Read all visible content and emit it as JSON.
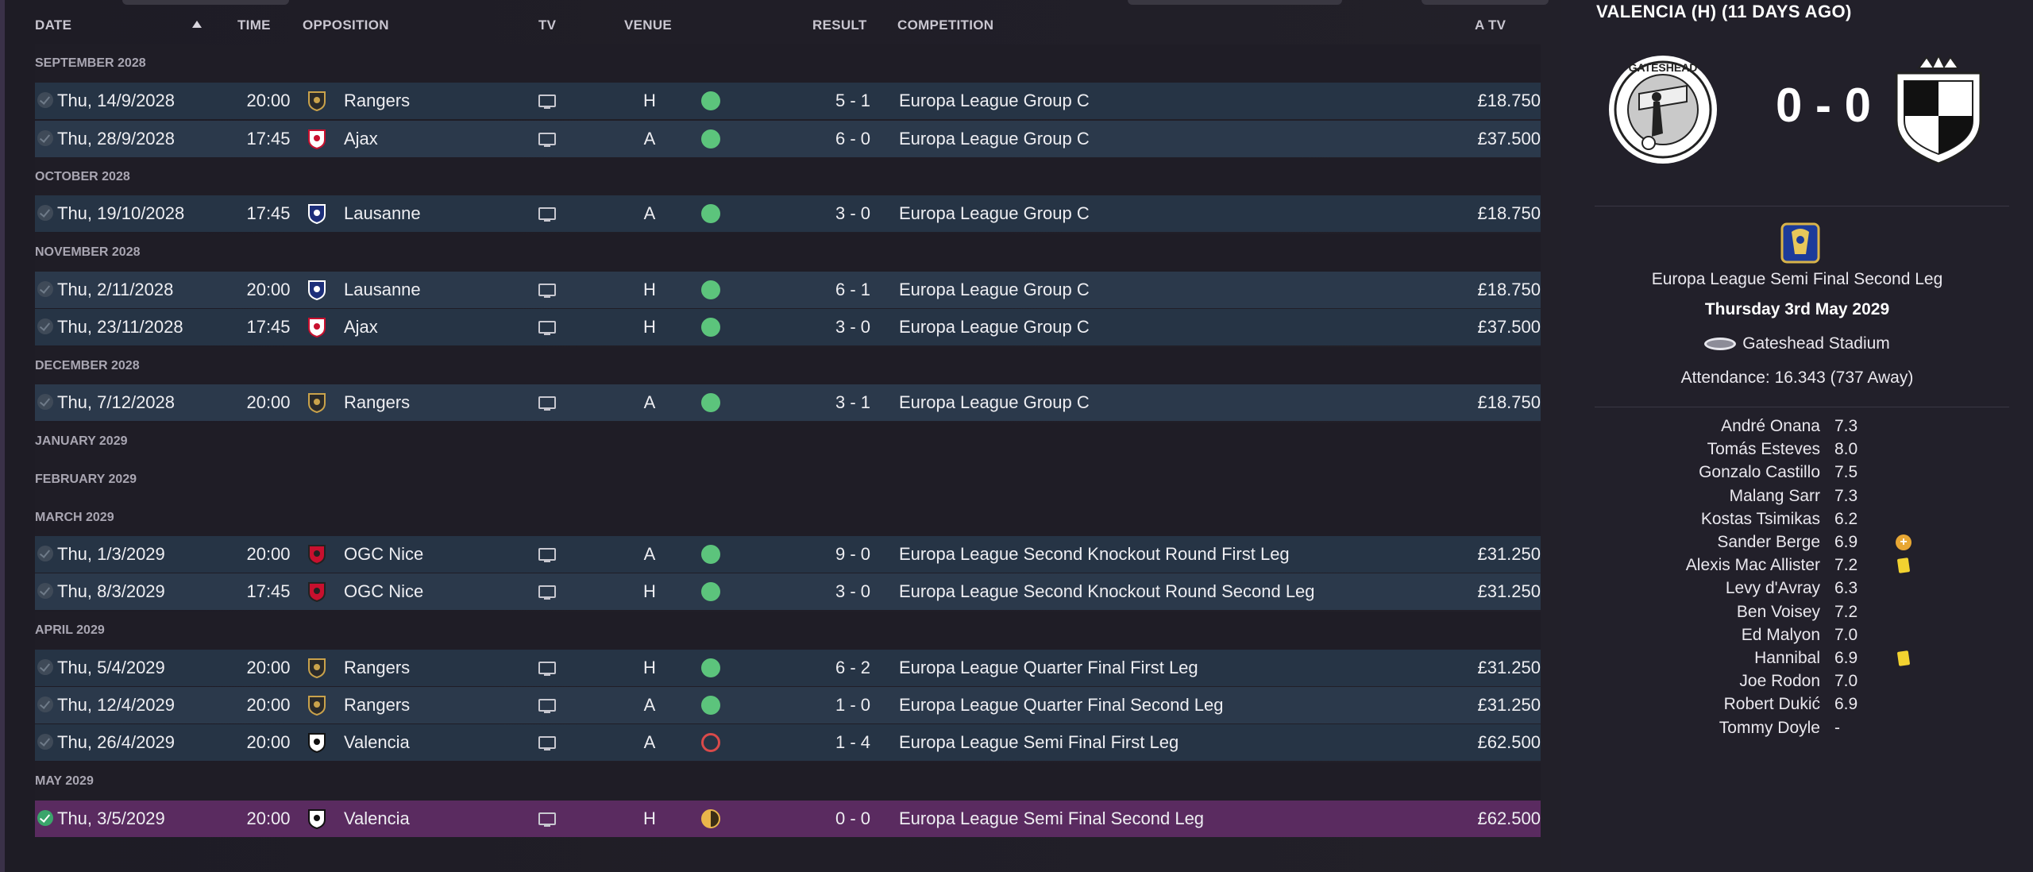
{
  "table": {
    "headers": {
      "date": "DATE",
      "time": "TIME",
      "opposition": "OPPOSITION",
      "tv": "TV",
      "venue": "VENUE",
      "result": "RESULT",
      "competition": "COMPETITION",
      "atv": "A TV"
    },
    "months": [
      "SEPTEMBER 2028",
      "OCTOBER 2028",
      "NOVEMBER 2028",
      "DECEMBER 2028",
      "JANUARY 2029",
      "FEBRUARY 2029",
      "MARCH 2029",
      "APRIL 2029",
      "MAY 2029"
    ],
    "rows": [
      {
        "date": "Thu, 14/9/2028",
        "time": "20:00",
        "opposition": "Rangers",
        "venue": "H",
        "outcome": "win",
        "result": "5 - 1",
        "competition": "Europa League Group C",
        "atv": "£18.750"
      },
      {
        "date": "Thu, 28/9/2028",
        "time": "17:45",
        "opposition": "Ajax",
        "venue": "A",
        "outcome": "win",
        "result": "6 - 0",
        "competition": "Europa League Group C",
        "atv": "£37.500"
      },
      {
        "date": "Thu, 19/10/2028",
        "time": "17:45",
        "opposition": "Lausanne",
        "venue": "A",
        "outcome": "win",
        "result": "3 - 0",
        "competition": "Europa League Group C",
        "atv": "£18.750"
      },
      {
        "date": "Thu, 2/11/2028",
        "time": "20:00",
        "opposition": "Lausanne",
        "venue": "H",
        "outcome": "win",
        "result": "6 - 1",
        "competition": "Europa League Group C",
        "atv": "£18.750"
      },
      {
        "date": "Thu, 23/11/2028",
        "time": "17:45",
        "opposition": "Ajax",
        "venue": "H",
        "outcome": "win",
        "result": "3 - 0",
        "competition": "Europa League Group C",
        "atv": "£37.500"
      },
      {
        "date": "Thu, 7/12/2028",
        "time": "20:00",
        "opposition": "Rangers",
        "venue": "A",
        "outcome": "win",
        "result": "3 - 1",
        "competition": "Europa League Group C",
        "atv": "£18.750"
      },
      {
        "date": "Thu, 1/3/2029",
        "time": "20:00",
        "opposition": "OGC Nice",
        "venue": "A",
        "outcome": "win",
        "result": "9 - 0",
        "competition": "Europa League Second Knockout Round First Leg",
        "atv": "£31.250"
      },
      {
        "date": "Thu, 8/3/2029",
        "time": "17:45",
        "opposition": "OGC Nice",
        "venue": "H",
        "outcome": "win",
        "result": "3 - 0",
        "competition": "Europa League Second Knockout Round Second Leg",
        "atv": "£31.250"
      },
      {
        "date": "Thu, 5/4/2029",
        "time": "20:00",
        "opposition": "Rangers",
        "venue": "H",
        "outcome": "win",
        "result": "6 - 2",
        "competition": "Europa League Quarter Final First Leg",
        "atv": "£31.250"
      },
      {
        "date": "Thu, 12/4/2029",
        "time": "20:00",
        "opposition": "Rangers",
        "venue": "A",
        "outcome": "win",
        "result": "1 - 0",
        "competition": "Europa League Quarter Final Second Leg",
        "atv": "£31.250"
      },
      {
        "date": "Thu, 26/4/2029",
        "time": "20:00",
        "opposition": "Valencia",
        "venue": "A",
        "outcome": "loss",
        "result": "1 - 4",
        "competition": "Europa League Semi Final First Leg",
        "atv": "£62.500"
      },
      {
        "date": "Thu, 3/5/2029",
        "time": "20:00",
        "opposition": "Valencia",
        "venue": "H",
        "outcome": "draw",
        "result": "0 - 0",
        "competition": "Europa League Semi Final Second Leg",
        "atv": "£62.500"
      }
    ]
  },
  "match": {
    "title": "VALENCIA (H) (11 DAYS AGO)",
    "score": "0 - 0",
    "home_crest_text": "GATESHEAD FOOTBALL CLUB",
    "competition": "Europa League Semi Final Second Leg",
    "date": "Thursday 3rd May 2029",
    "stadium": "Gateshead Stadium",
    "attendance": "Attendance: 16.343 (737 Away)"
  },
  "players": [
    {
      "name": "André Onana",
      "rating": "7.3",
      "event": ""
    },
    {
      "name": "Tomás Esteves",
      "rating": "8.0",
      "event": ""
    },
    {
      "name": "Gonzalo Castillo",
      "rating": "7.5",
      "event": ""
    },
    {
      "name": "Malang Sarr",
      "rating": "7.3",
      "event": ""
    },
    {
      "name": "Kostas Tsimikas",
      "rating": "6.2",
      "event": ""
    },
    {
      "name": "Sander Berge",
      "rating": "6.9",
      "event": "substitution"
    },
    {
      "name": "Alexis Mac Allister",
      "rating": "7.2",
      "event": "yellow-card"
    },
    {
      "name": "Levy d'Avray",
      "rating": "6.3",
      "event": ""
    },
    {
      "name": "Ben Voisey",
      "rating": "7.2",
      "event": ""
    },
    {
      "name": "Ed Malyon",
      "rating": "7.0",
      "event": ""
    },
    {
      "name": "Hannibal",
      "rating": "6.9",
      "event": "yellow-card"
    },
    {
      "name": "Joe Rodon",
      "rating": "7.0",
      "event": ""
    },
    {
      "name": "Robert Dukić",
      "rating": "6.9",
      "event": ""
    },
    {
      "name": "Tommy Doyle",
      "rating": "-",
      "event": ""
    }
  ],
  "colors": {
    "win": "#5cc47c",
    "loss": "#d94a4a",
    "draw": "#e9b64b",
    "current_row": "#5a2b60",
    "row": "#263445"
  }
}
